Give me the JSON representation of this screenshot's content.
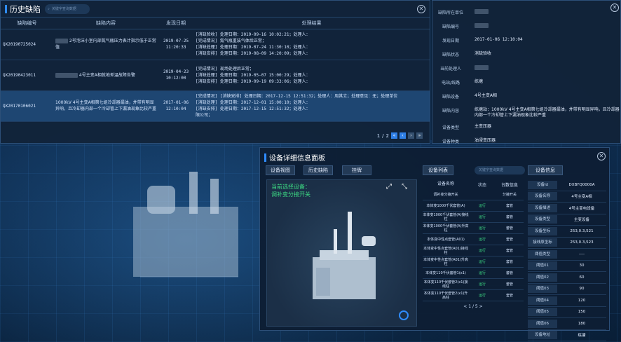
{
  "history": {
    "title": "历史缺陷",
    "search_placeholder": "关键字查询数据",
    "columns": [
      "缺陷编号",
      "缺陷内容",
      "发现日期",
      "处理结果"
    ],
    "rows": [
      {
        "id": "QX20190725024",
        "content": "2号泡沫小室内部氮气瓶压力表计指示低于正常值",
        "date": "2019-07-25 11:20:33",
        "results": [
          "[消缺验收] 处理日期：2019-09-16 10:02:21；处理人：",
          "[完成情况] 氮气瓶重装气体后正常；",
          "[消缺处理] 处理日期：2019-07-24 11:30:10；处理人：",
          "[消缺安排] 处理日期：2019-08-09 14:20:09；处理人："
        ],
        "result_tail": "；处理意见：无；处理单位：检修公司；"
      },
      {
        "id": "QX20190423011",
        "content": "4号主变A相就地差温故障告警",
        "date": "2019-04-23 10:12:00",
        "results": [
          "[完成情况] 现场处理后正常；",
          "[消缺处理] 处理日期：2019-05-07 15:00:29；处理人：",
          "[消缺安排] 处理日期：2019-09-19 09:33:06；处理人："
        ],
        "result_tail": "；处理意见：无；处理单位：检修公司；"
      },
      {
        "id": "QX20170106021",
        "content": "1000kV 4号主变A相第七组冷却器漏油，并带有明显异响，且冷却器内部一个冷却管上下漏油现象比较严重",
        "date": "2017-01-06 12:10:04",
        "results": [
          "[完成情况] [消缺安排] 处理日期：2017-12-15 12:51:32；处理人：周其立；处理意见：无；处理单位",
          "[消缺处理] 处理日期：2017-12-01 15:00:10；处理人：",
          "[消缺安排] 处理日期：2017-12-15 12:51:32；处理人：",
          "限公司；"
        ],
        "result_tail": "；处理意见：无；处理单位：检修公司；"
      }
    ],
    "pager": {
      "page": "1",
      "sep": "/",
      "total": "2"
    }
  },
  "detail": {
    "items": [
      {
        "k": "缺陷所在单位",
        "v": ""
      },
      {
        "k": "缺陷编号",
        "v": ""
      },
      {
        "k": "发现日期",
        "v": "2017-01-06 12:10:04"
      },
      {
        "k": "缺陷状态",
        "v": "消缺验收"
      },
      {
        "k": "当前处理人",
        "v": ""
      },
      {
        "k": "电站/线路",
        "v": "练塘"
      },
      {
        "k": "缺陷设备",
        "v": "4号主变A相"
      },
      {
        "k": "缺陷内容",
        "v": "练塘站：1000kV 4号主变A相第七组冷却器漏油，并带有明显异响，且冷却器内部一个冷却管上下漏油现象比较严重"
      },
      {
        "k": "设备类型",
        "v": "主变压器"
      },
      {
        "k": "设备种类",
        "v": "油浸变压器"
      }
    ]
  },
  "equip": {
    "title": "设备详细信息面板",
    "tabs": [
      "设备视图",
      "历史缺陷",
      "挂牌"
    ],
    "list_btn": "设备列表",
    "info_btn": "设备信息",
    "search_placeholder": "关键字查询数据",
    "current_label": "当前选择设备：",
    "current_value": "调补变分接开关",
    "list_headers": [
      "设备名称",
      "状态",
      "台数信息"
    ],
    "list_rows": [
      {
        "name": "调补变分接开关",
        "status": "",
        "info": "分接开关"
      },
      {
        "name": "本体变1000千伏套管(A)",
        "status": "运行",
        "info": "套管"
      },
      {
        "name": "本体变1000千伏套管(A)接线柱",
        "status": "运行",
        "info": "套管"
      },
      {
        "name": "本体变1000千伏套管(A)升高柱",
        "status": "运行",
        "info": "套管"
      },
      {
        "name": "本体变中性点套管(A01)",
        "status": "运行",
        "info": "套管"
      },
      {
        "name": "本体变中性点套管(A01)接线柱",
        "status": "运行",
        "info": "套管"
      },
      {
        "name": "本体变中性点套管(A01)升高柱",
        "status": "运行",
        "info": "套管"
      },
      {
        "name": "本体变110千伏套管1(x1)",
        "status": "运行",
        "info": "套管"
      },
      {
        "name": "本体变110千伏套管2(x1)接线柱",
        "status": "运行",
        "info": "套管"
      },
      {
        "name": "本体变110千伏套管2(x1)升高柱",
        "status": "运行",
        "info": "套管"
      }
    ],
    "list_pager": "1 / 5",
    "info_rows": [
      {
        "k": "设备Id",
        "v": "DXBYQ0000A"
      },
      {
        "k": "设备名称",
        "v": "4号主变A相"
      },
      {
        "k": "设备描述",
        "v": "4号主变电设备"
      },
      {
        "k": "设备类型",
        "v": "主变设备"
      },
      {
        "k": "设备坐标",
        "v": "253,0.3,521"
      },
      {
        "k": "接线原坐标",
        "v": "253,0.3,523"
      },
      {
        "k": "阈值类型",
        "v": "----"
      },
      {
        "k": "阈值01",
        "v": "30"
      },
      {
        "k": "阈值02",
        "v": "60"
      },
      {
        "k": "阈值03",
        "v": "90"
      },
      {
        "k": "阈值04",
        "v": "120"
      },
      {
        "k": "阈值05",
        "v": "150"
      },
      {
        "k": "阈值06",
        "v": "180"
      },
      {
        "k": "设备地址",
        "v": "练塘"
      }
    ]
  }
}
